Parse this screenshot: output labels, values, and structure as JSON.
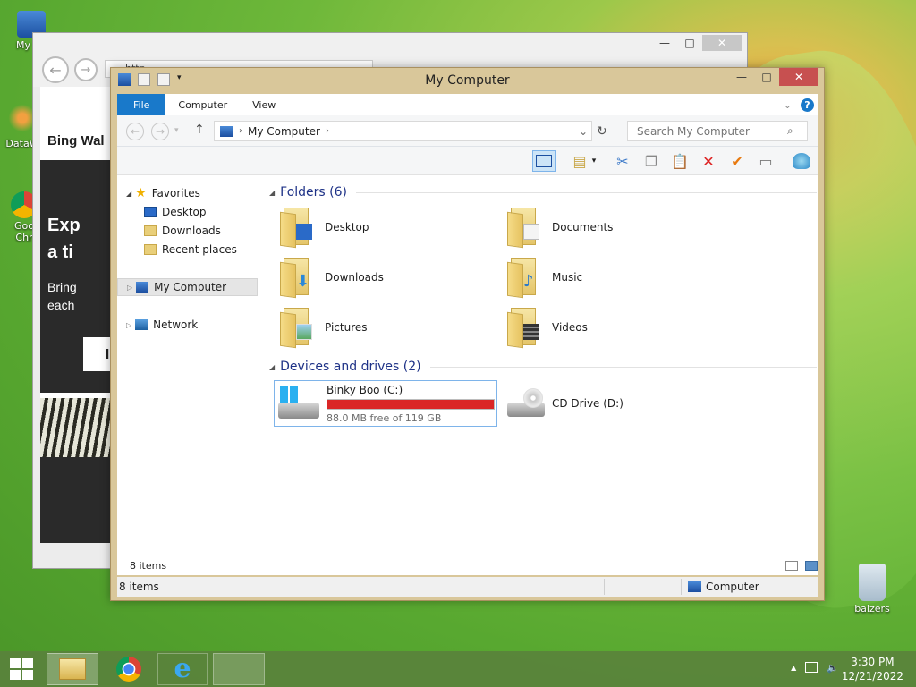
{
  "desktop": {
    "icons": [
      {
        "label": "My Co"
      },
      {
        "label": "DataW"
      },
      {
        "label": "Goo"
      },
      {
        "label": "Chr"
      },
      {
        "label": "balzers"
      }
    ]
  },
  "browser": {
    "address_fragment": "http",
    "page_title": "Bing Wal",
    "hero_line1": "Exp",
    "hero_line2": "a ti",
    "hero_line3": "Bring",
    "hero_line4": "each",
    "button_fragment": "I"
  },
  "explorer": {
    "title": "My Computer",
    "tabs": [
      "File",
      "Computer",
      "View"
    ],
    "address": {
      "location": "My Computer",
      "separator": "›",
      "dropdown_glyph": "⌄",
      "refresh_glyph": "↻"
    },
    "search_placeholder": "Search My Computer",
    "nav": {
      "favorites_label": "Favorites",
      "favorites": [
        "Desktop",
        "Downloads",
        "Recent places"
      ],
      "my_computer_label": "My Computer",
      "network_label": "Network"
    },
    "folders_header": "Folders (6)",
    "folders": [
      "Desktop",
      "Documents",
      "Downloads",
      "Music",
      "Pictures",
      "Videos"
    ],
    "devices_header": "Devices and drives (2)",
    "drives": [
      {
        "name": "Binky Boo (C:)",
        "free_text": "88.0 MB free of 119 GB",
        "used_fraction": 0.999
      },
      {
        "name": "CD Drive (D:)"
      }
    ],
    "item_count_inner": "8 items",
    "status_left": "8 items",
    "status_right": "Computer"
  },
  "taskbar": {
    "time": "3:30 PM",
    "date": "12/21/2022",
    "tray_up": "▲"
  },
  "colors": {
    "file_tab": "#1979ca",
    "drive_fill": "#da2626",
    "header_text": "#1e3287"
  }
}
